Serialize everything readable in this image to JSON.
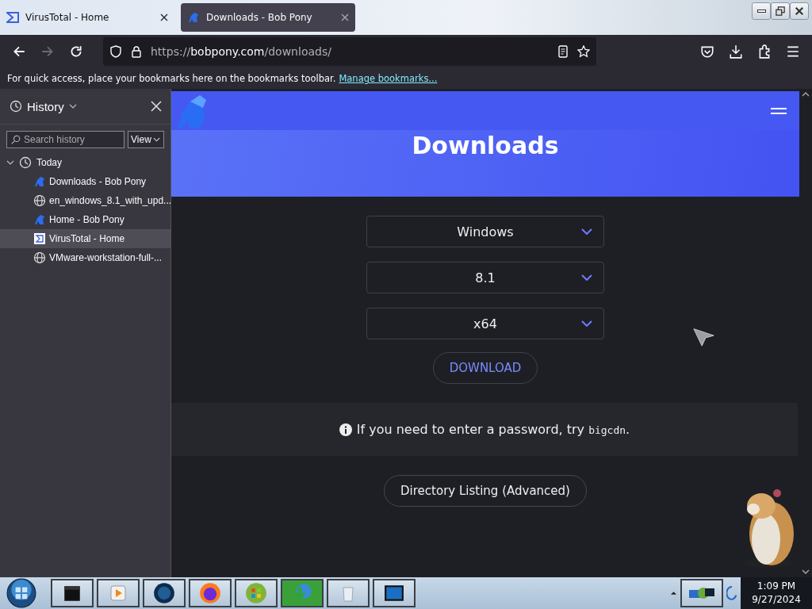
{
  "tabs": [
    {
      "title": "VirusTotal - Home",
      "kind": "virustotal",
      "selected": false
    },
    {
      "title": "Downloads - Bob Pony",
      "kind": "pony",
      "selected": true
    }
  ],
  "address_bar": {
    "url_prefix": "https://",
    "url_domain": "bobpony.com",
    "url_path": "/downloads/"
  },
  "bookmarks_bar": {
    "message": "For quick access, place your bookmarks here on the bookmarks toolbar.",
    "link": "Manage bookmarks..."
  },
  "sidebar": {
    "title": "History",
    "search_placeholder": "Search history",
    "view_button": "View",
    "groups": [
      {
        "label": "Today",
        "expanded": true,
        "children": [
          {
            "title": "Downloads - Bob Pony",
            "kind": "pony",
            "selected": false
          },
          {
            "title": "en_windows_8.1_with_upd...",
            "kind": "globe",
            "selected": false
          },
          {
            "title": "Home - Bob Pony",
            "kind": "pony",
            "selected": false
          },
          {
            "title": "VirusTotal - Home",
            "kind": "virustotal",
            "selected": true
          },
          {
            "title": "VMware-workstation-full-...",
            "kind": "globe",
            "selected": false
          }
        ]
      }
    ]
  },
  "page": {
    "heading": "Downloads",
    "selects": [
      {
        "value": "Windows"
      },
      {
        "value": "8.1"
      },
      {
        "value": "x64"
      }
    ],
    "download_button": "DOWNLOAD",
    "notice_text": "If you need to enter a password, try",
    "notice_code": "bigcdn",
    "notice_end": ".",
    "directory_button": "Directory Listing (Advanced)"
  },
  "taskbar": {
    "time": "1:09 PM",
    "date": "9/27/2024"
  }
}
